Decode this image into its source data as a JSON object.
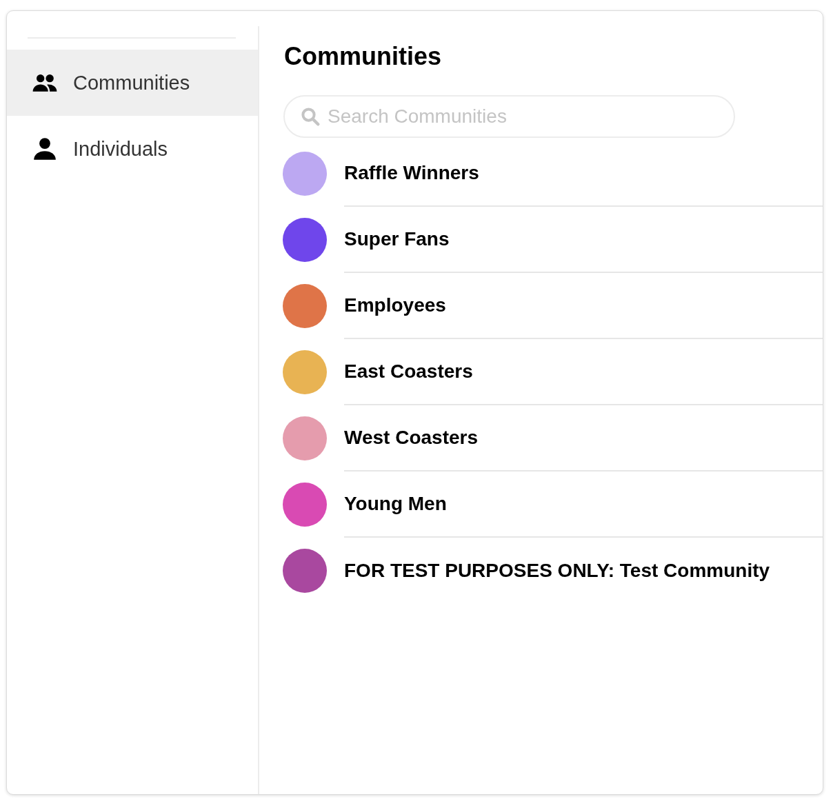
{
  "sidebar": {
    "items": [
      {
        "label": "Communities",
        "kind": "group",
        "selected": true
      },
      {
        "label": "Individuals",
        "kind": "person",
        "selected": false
      }
    ]
  },
  "main": {
    "title": "Communities",
    "search": {
      "placeholder": "Search Communities"
    },
    "communities": [
      {
        "name": "Raffle Winners",
        "color": "#bca8f2"
      },
      {
        "name": "Super Fans",
        "color": "#6f46eb"
      },
      {
        "name": "Employees",
        "color": "#df7448"
      },
      {
        "name": "East Coasters",
        "color": "#e8b353"
      },
      {
        "name": "West Coasters",
        "color": "#e59cad"
      },
      {
        "name": "Young Men",
        "color": "#d94ab3"
      },
      {
        "name": "FOR TEST PURPOSES ONLY: Test Community",
        "color": "#a9489f"
      }
    ]
  }
}
